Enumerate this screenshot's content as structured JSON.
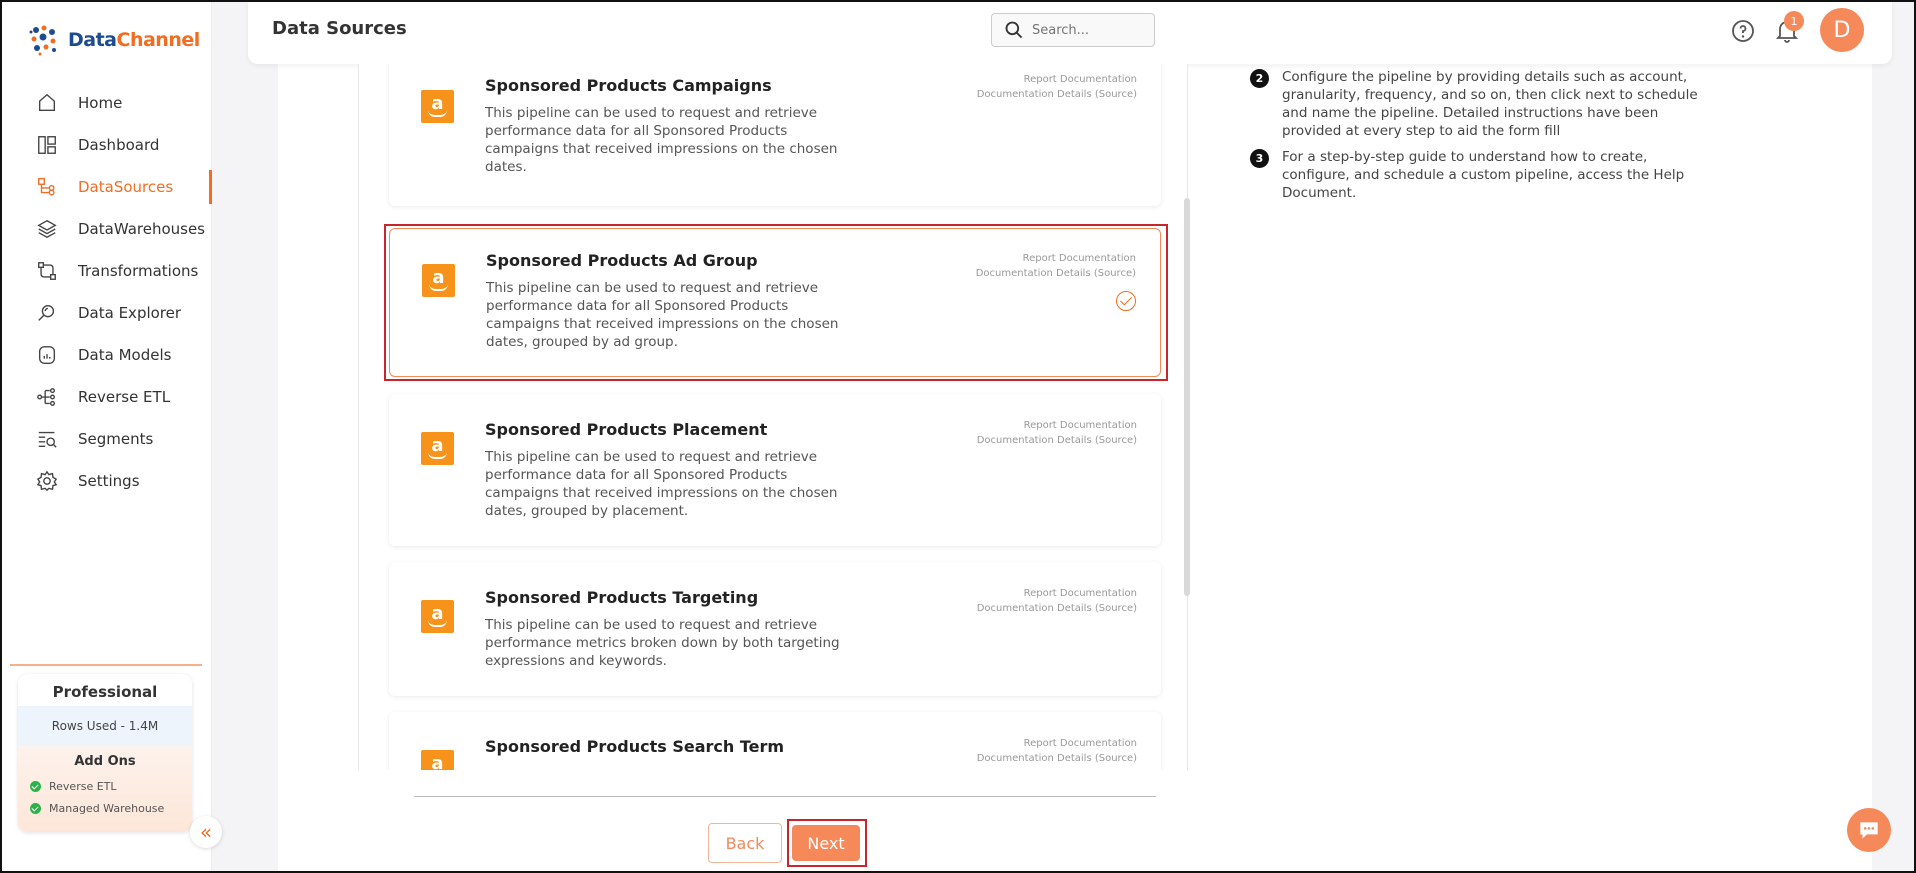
{
  "brand": {
    "name_part1": "Data",
    "name_part2": "Channel",
    "accent": "#f26d21"
  },
  "header": {
    "title": "Data Sources",
    "search_placeholder": "Search...",
    "notification_count": "1",
    "avatar_initial": "D"
  },
  "sidebar": {
    "items": [
      {
        "label": "Home",
        "icon": "home-icon"
      },
      {
        "label": "Dashboard",
        "icon": "dashboard-icon"
      },
      {
        "label": "DataSources",
        "icon": "datasources-icon",
        "active": true
      },
      {
        "label": "DataWarehouses",
        "icon": "layers-icon"
      },
      {
        "label": "Transformations",
        "icon": "transform-icon"
      },
      {
        "label": "Data Explorer",
        "icon": "explorer-icon"
      },
      {
        "label": "Data Models",
        "icon": "models-icon"
      },
      {
        "label": "Reverse ETL",
        "icon": "reverse-etl-icon"
      },
      {
        "label": "Segments",
        "icon": "segments-icon"
      },
      {
        "label": "Settings",
        "icon": "gear-icon"
      }
    ]
  },
  "plan": {
    "title": "Professional",
    "rows_used": "Rows Used - 1.4M",
    "addons_title": "Add Ons",
    "addons": [
      "Reverse ETL",
      "Managed Warehouse"
    ]
  },
  "pipelines": [
    {
      "title": "Sponsored Products Campaigns",
      "desc": "This pipeline can be used to request and retrieve performance data for all Sponsored Products campaigns that received impressions on the chosen dates.",
      "link1": "Report Documentation",
      "link2": "Documentation Details (Source)"
    },
    {
      "title": "Sponsored Products Ad Group",
      "desc": "This pipeline can be used to request and retrieve performance data for all Sponsored Products campaigns that received impressions on the chosen dates, grouped by ad group.",
      "link1": "Report Documentation",
      "link2": "Documentation Details (Source)",
      "selected": true
    },
    {
      "title": "Sponsored Products Placement",
      "desc": "This pipeline can be used to request and retrieve performance data for all Sponsored Products campaigns that received impressions on the chosen dates, grouped by placement.",
      "link1": "Report Documentation",
      "link2": "Documentation Details (Source)"
    },
    {
      "title": "Sponsored Products Targeting",
      "desc": "This pipeline can be used to request and retrieve performance metrics broken down by both targeting expressions and keywords.",
      "link1": "Report Documentation",
      "link2": "Documentation Details (Source)"
    },
    {
      "title": "Sponsored Products Search Term",
      "desc": "",
      "link1": "Report Documentation",
      "link2": "Documentation Details (Source)"
    }
  ],
  "instructions": [
    {
      "num": "2",
      "text": "Configure the pipeline by providing details such as account, granularity, frequency, and so on, then click next to schedule and name the pipeline. Detailed instructions have been provided at every step to aid the form fill"
    },
    {
      "num": "3",
      "text": "For a step-by-step guide to understand how to create, configure, and schedule a custom pipeline, access the Help Document."
    }
  ],
  "footer": {
    "back_label": "Back",
    "next_label": "Next"
  }
}
